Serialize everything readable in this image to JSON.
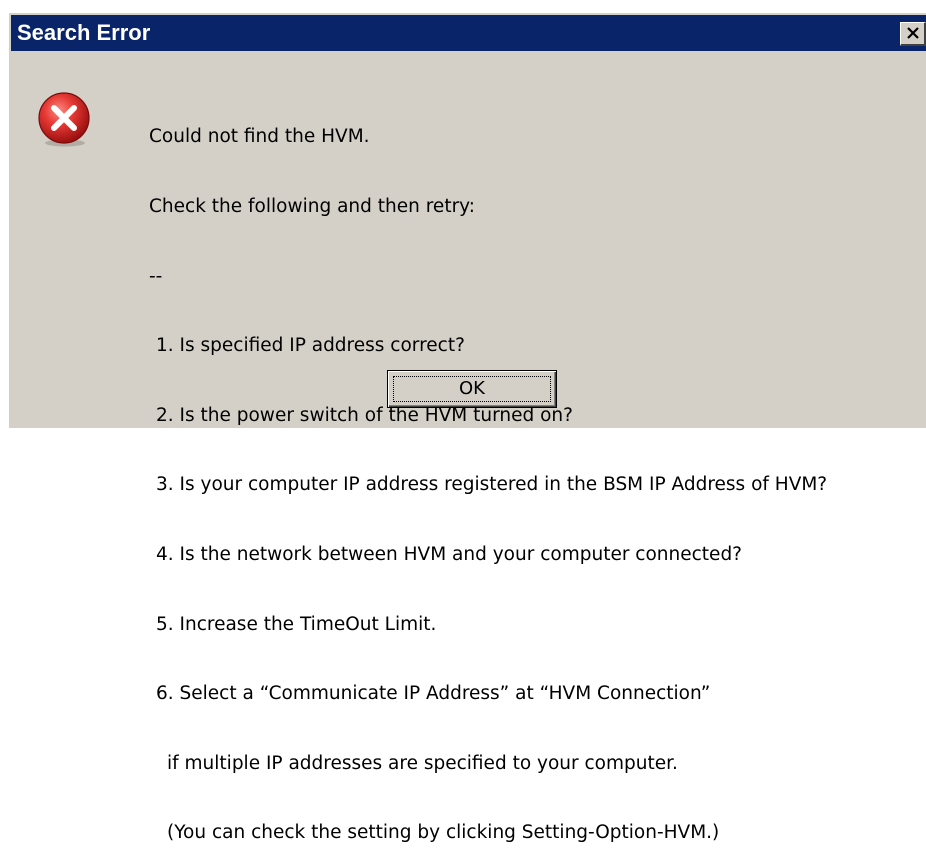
{
  "window": {
    "title": "Search Error",
    "close_icon": "close-icon"
  },
  "icon": {
    "name": "error-icon",
    "color": "#d62e2e"
  },
  "message": {
    "line1": "Could not find the HVM.",
    "line2": "Check the following and then retry:",
    "separator": "--",
    "items": [
      "1. Is specified IP address correct?",
      "2. Is the power switch of the HVM turned on?",
      "3. Is your computer IP address registered in the BSM IP Address of HVM?",
      "4. Is the network between HVM and your computer connected?",
      "5. Increase the TimeOut Limit.",
      "6. Select a “Communicate IP Address” at “HVM Connection”"
    ],
    "item6_cont1": "if multiple IP addresses are specified to your computer.",
    "item6_cont2": "(You can check the setting by clicking Setting-Option-HVM.)"
  },
  "buttons": {
    "ok_label": "OK"
  },
  "colors": {
    "titlebar": "#0a246a",
    "dialog_face": "#d4d0c8"
  }
}
